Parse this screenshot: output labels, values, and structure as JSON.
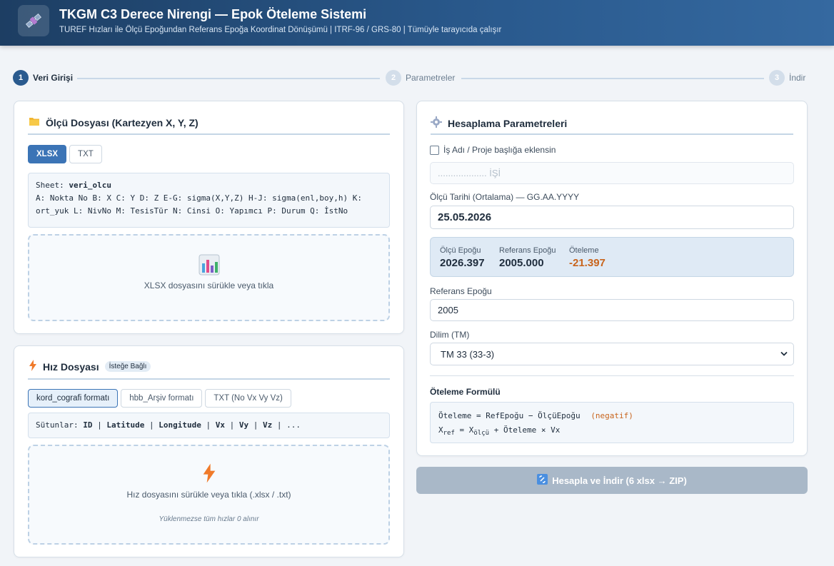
{
  "header": {
    "title": "TKGM C3 Derece Nirengi — Epok Öteleme Sistemi",
    "subtitle": "TUREF Hızları ile Ölçü Epoğundan Referans Epoğa Koordinat Dönüşümü  |  ITRF-96 / GRS-80  |  Tümüyle tarayıcıda çalışır",
    "logo_icon": "satellite-icon"
  },
  "stepper": {
    "steps": [
      {
        "num": "1",
        "label": "Veri Girişi",
        "active": true
      },
      {
        "num": "2",
        "label": "Parametreler",
        "active": false
      },
      {
        "num": "3",
        "label": "İndir",
        "active": false
      }
    ]
  },
  "measurement": {
    "icon": "folder-icon",
    "title": "Ölçü Dosyası (Kartezyen X, Y, Z)",
    "tabs": [
      "XLSX",
      "TXT"
    ],
    "sheet_label": "Sheet:",
    "sheet_name": "veri_olcu",
    "columns_text": "A: Nokta No  B: X  C: Y  D: Z  E-G: sigma(X,Y,Z)  H-J: sigma(enl,boy,h)  K: ort_yuk  L: NivNo  M: TesisTür  N: Cinsi  O: Yapımcı  P: Durum  Q: İstNo",
    "drop_icon": "spreadsheet-icon",
    "drop_text": "XLSX dosyasını sürükle veya tıkla"
  },
  "velocity": {
    "icon": "lightning-icon",
    "title": "Hız Dosyası",
    "badge": "İsteğe Bağlı",
    "tabs": [
      "kord_cografi formatı",
      "hbb_Arşiv formatı",
      "TXT (No Vx Vy Vz)"
    ],
    "columns_label": "Sütunlar:",
    "columns": [
      "ID",
      "Latitude",
      "Longitude",
      "Vx",
      "Vy",
      "Vz",
      "..."
    ],
    "drop_text": "Hız dosyasını sürükle veya tıkla (.xlsx / .txt)",
    "drop_note": "Yüklenmezse tüm hızlar 0 alınır"
  },
  "params": {
    "icon": "gear-icon",
    "title": "Hesaplama Parametreleri",
    "checkbox_label": "İş Adı / Proje başlığa eklensin",
    "project_placeholder": "................... İŞİ",
    "date_label": "Ölçü Tarihi (Ortalama) — GG.AA.YYYY",
    "date_value": "25.05.2026",
    "epoch": {
      "measure_label": "Ölçü Epoğu",
      "measure_value": "2026.397",
      "ref_label": "Referans Epoğu",
      "ref_value": "2005.000",
      "shift_label": "Öteleme",
      "shift_value": "-21.397"
    },
    "ref_epoch_label": "Referans Epoğu",
    "ref_epoch_value": "2005",
    "zone_label": "Dilim (TM)",
    "zone_value": "TM 33 (33-3)",
    "formula_title": "Öteleme Formülü",
    "formula_line1": "Öteleme = RefEpoğu − ÖlçüEpoğu",
    "formula_negative": "(negatif)",
    "formula_x": "X",
    "formula_ref_sub": "ref",
    "formula_eq": " = X",
    "formula_olcu_sub": "ölçü",
    "formula_rest": " + Öteleme × Vx"
  },
  "action_button": {
    "icon": "link-icon",
    "label": "Hesapla ve İndir (6 xlsx → ZIP)"
  },
  "colors": {
    "header_start": "#1d3e63",
    "accent": "#3b74b6",
    "negative": "#c8641c",
    "disabled_button": "#a9b8c8"
  }
}
